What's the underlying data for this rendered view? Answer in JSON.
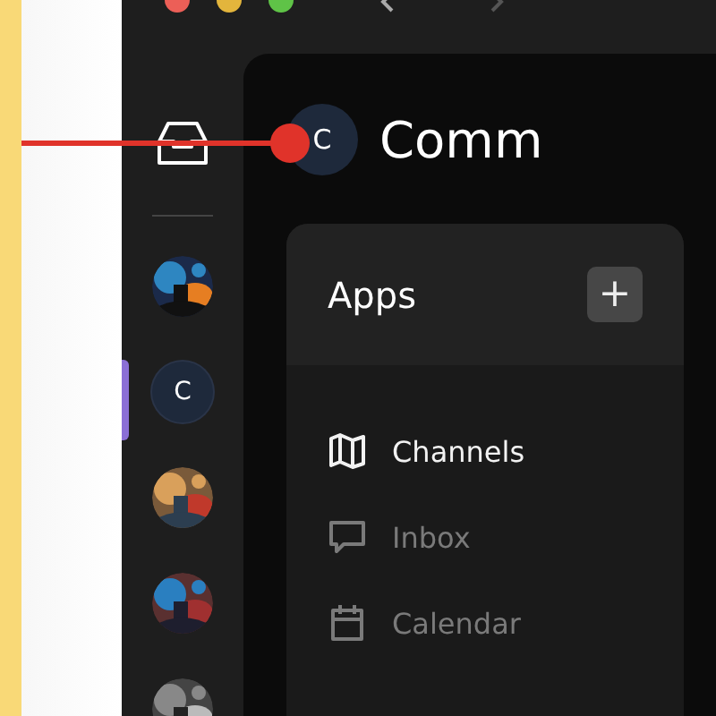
{
  "workspace": {
    "avatar_letter": "C",
    "title": "Comm"
  },
  "sidebar": {
    "items": [
      {
        "kind": "picture",
        "selected": false
      },
      {
        "kind": "letter",
        "letter": "C",
        "selected": true
      },
      {
        "kind": "picture",
        "selected": false
      },
      {
        "kind": "picture",
        "selected": false
      },
      {
        "kind": "picture",
        "selected": false
      }
    ]
  },
  "apps": {
    "title": "Apps",
    "add_label": "+",
    "items": [
      {
        "kind": "map",
        "label": "Channels",
        "selected": true
      },
      {
        "kind": "chat",
        "label": "Inbox",
        "selected": false
      },
      {
        "kind": "calendar",
        "label": "Calendar",
        "selected": false
      }
    ]
  }
}
